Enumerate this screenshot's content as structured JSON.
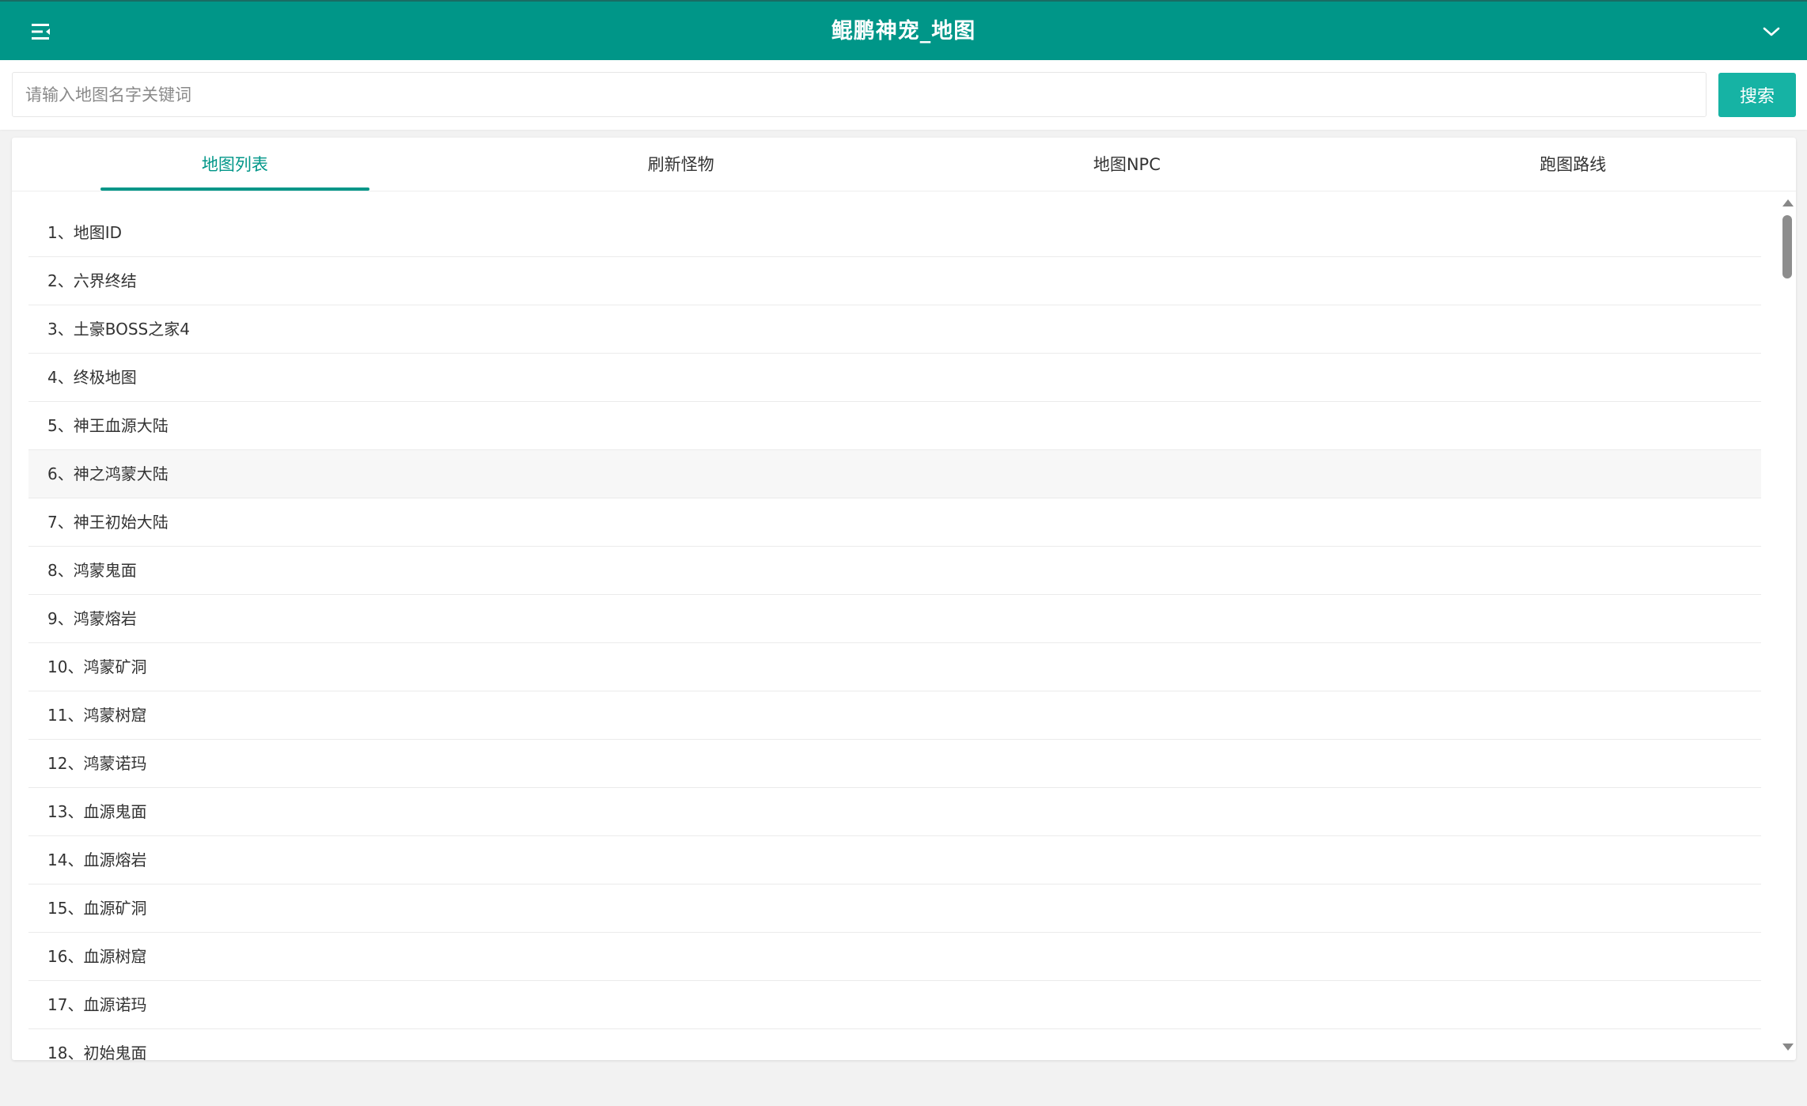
{
  "header": {
    "title": "鲲鹏神宠_地图",
    "menu_icon": "menu-collapse-icon",
    "dropdown_icon": "chevron-down-icon",
    "background_color": "#009688"
  },
  "search": {
    "placeholder": "请输入地图名字关键词",
    "value": "",
    "button_label": "搜索",
    "button_color": "#16b3a4"
  },
  "tabs": [
    {
      "label": "地图列表",
      "active": true
    },
    {
      "label": "刷新怪物",
      "active": false
    },
    {
      "label": "地图NPC",
      "active": false
    },
    {
      "label": "跑图路线",
      "active": false
    }
  ],
  "map_list": [
    "1、地图ID",
    "2、六界终结",
    "3、土豪BOSS之家4",
    "4、终极地图",
    "5、神王血源大陆",
    "6、神之鸿蒙大陆",
    "7、神王初始大陆",
    "8、鸿蒙鬼面",
    "9、鸿蒙熔岩",
    "10、鸿蒙矿洞",
    "11、鸿蒙树窟",
    "12、鸿蒙诺玛",
    "13、血源鬼面",
    "14、血源熔岩",
    "15、血源矿洞",
    "16、血源树窟",
    "17、血源诺玛",
    "18、初始鬼面"
  ],
  "accent_color": "#009688"
}
